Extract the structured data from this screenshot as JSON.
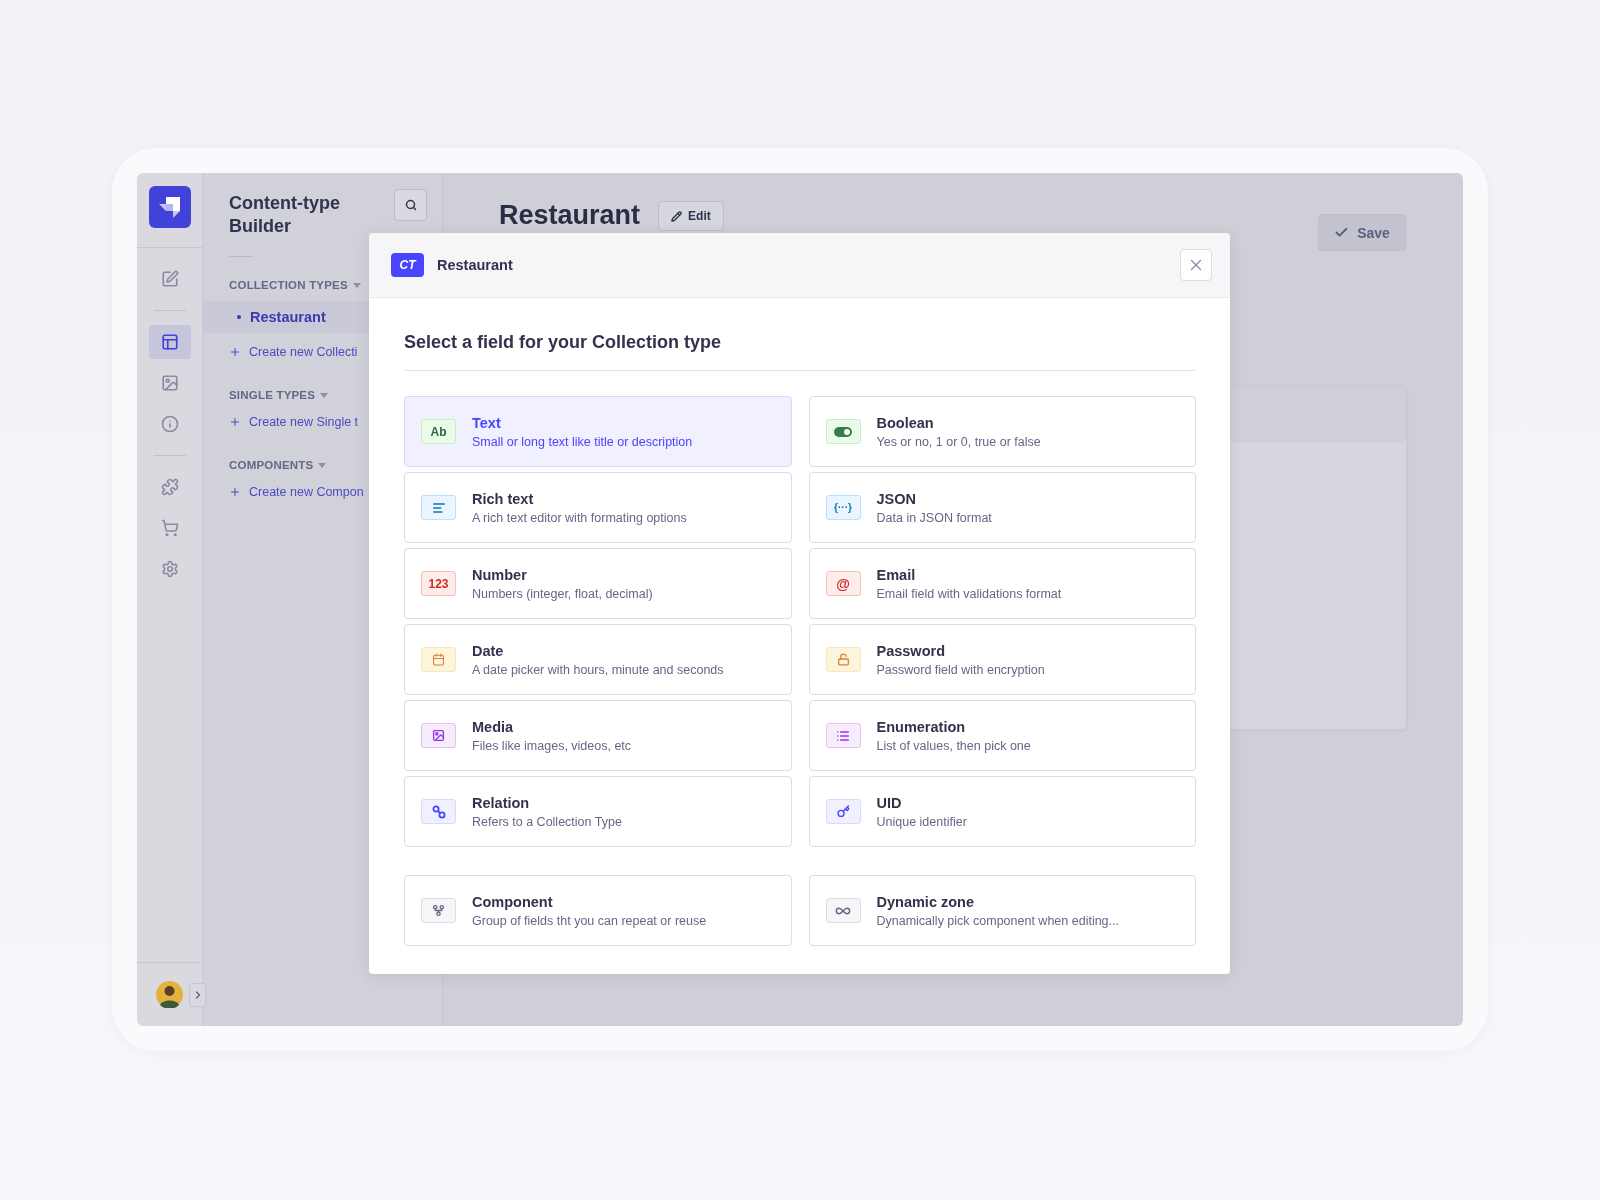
{
  "rail": {
    "groups": [
      [
        {
          "selected": false
        }
      ],
      [
        {
          "selected": true
        },
        {
          "selected": false
        },
        {
          "selected": false
        }
      ],
      [
        {
          "selected": false
        },
        {
          "selected": false
        },
        {
          "selected": false
        }
      ]
    ]
  },
  "subnav": {
    "title": "Content-type Builder",
    "sections": [
      {
        "label": "COLLECTION TYPES",
        "items": [
          {
            "label": "Restaurant",
            "selected": true
          }
        ],
        "create_link": "Create new Collecti"
      },
      {
        "label": "SINGLE TYPES",
        "create_link": "Create new Single t"
      },
      {
        "label": "COMPONENTS",
        "create_link": "Create new Compon"
      }
    ]
  },
  "header": {
    "title": "Restaurant",
    "edit_button": "Edit",
    "save_button": "Save"
  },
  "modal": {
    "badge": "CT",
    "title": "Restaurant",
    "heading": "Select a field for your Collection type",
    "fields": [
      {
        "kind": "text",
        "badge": "Ab",
        "name": "Text",
        "description": "Small or long text like title or description",
        "selected": true
      },
      {
        "kind": "boolean",
        "name": "Boolean",
        "description": "Yes or no, 1 or 0, true or false",
        "selected": false
      },
      {
        "kind": "richtext",
        "name": "Rich text",
        "description": "A rich text editor with formating options",
        "selected": false
      },
      {
        "kind": "json",
        "badge": "{···}",
        "name": "JSON",
        "description": "Data in JSON format",
        "selected": false
      },
      {
        "kind": "number",
        "badge": "123",
        "name": "Number",
        "description": "Numbers (integer, float, decimal)",
        "selected": false
      },
      {
        "kind": "email",
        "badge": "@",
        "name": "Email",
        "description": "Email field with validations format",
        "selected": false
      },
      {
        "kind": "date",
        "name": "Date",
        "description": "A date picker with hours, minute and seconds",
        "selected": false
      },
      {
        "kind": "password",
        "name": "Password",
        "description": "Password field with encryption",
        "selected": false
      },
      {
        "kind": "media",
        "name": "Media",
        "description": "Files like images, videos, etc",
        "selected": false
      },
      {
        "kind": "enumeration",
        "name": "Enumeration",
        "description": "List of values, then pick one",
        "selected": false
      },
      {
        "kind": "relation",
        "name": "Relation",
        "description": "Refers to a Collection Type",
        "selected": false
      },
      {
        "kind": "uid",
        "name": "UID",
        "description": "Unique identifier",
        "selected": false
      }
    ],
    "extra_fields": [
      {
        "kind": "component",
        "name": "Component",
        "description": "Group of fields tht you can repeat or reuse",
        "selected": false
      },
      {
        "kind": "dynamiczone",
        "name": "Dynamic zone",
        "description": "Dynamically pick component when editing...",
        "selected": false
      }
    ]
  }
}
